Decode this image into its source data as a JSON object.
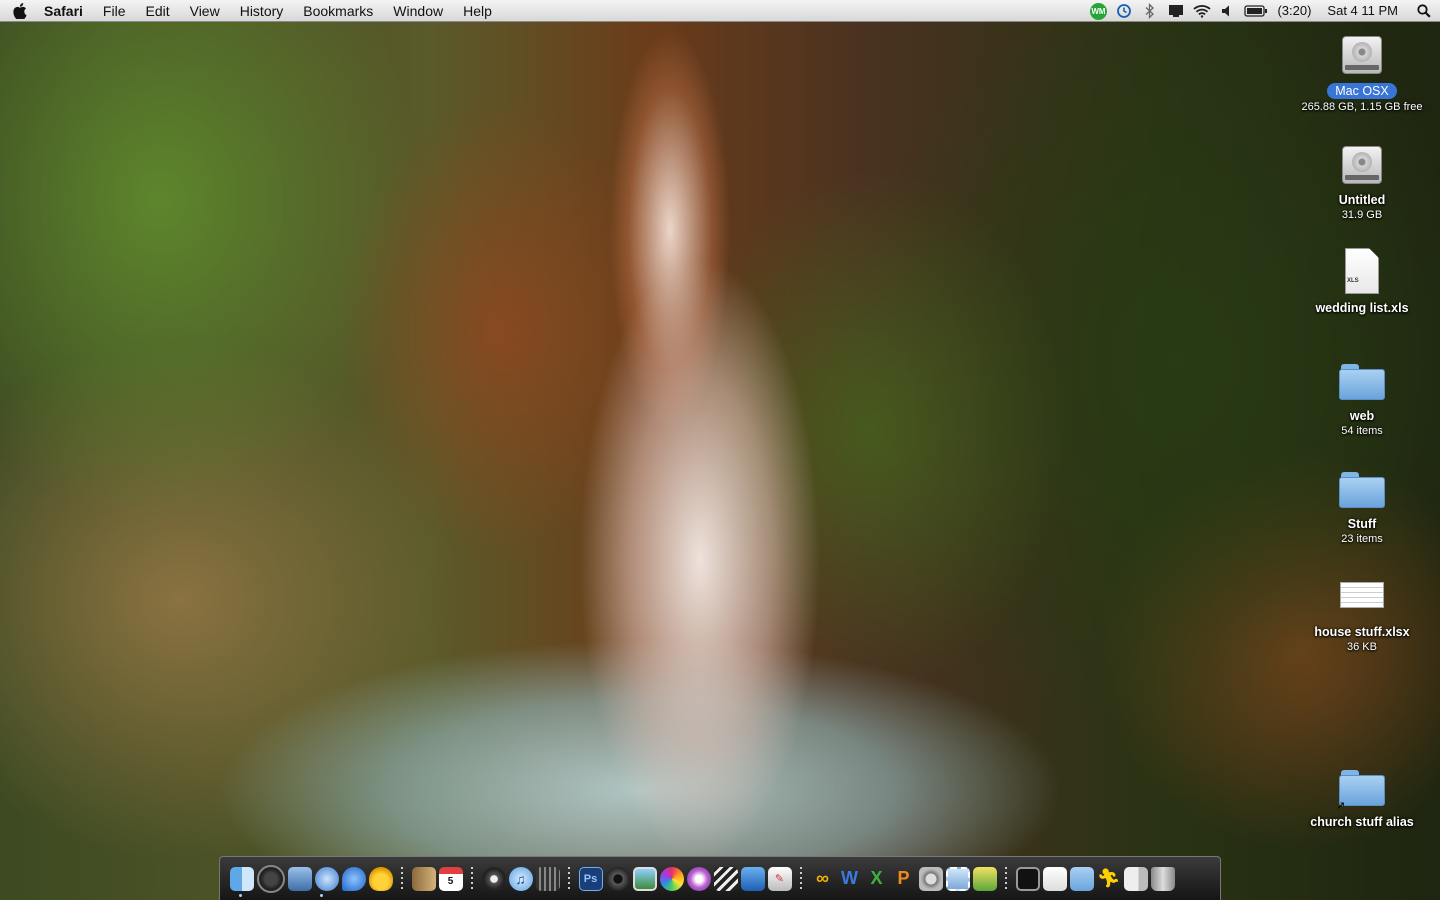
{
  "menubar": {
    "app_name": "Safari",
    "menus": [
      "File",
      "Edit",
      "View",
      "History",
      "Bookmarks",
      "Window",
      "Help"
    ],
    "status": {
      "wm_badge": "WM",
      "battery": "(3:20)",
      "clock": "Sat 4 11 PM"
    }
  },
  "desktop": {
    "items": [
      {
        "name": "Mac OSX",
        "info": "265.88 GB, 1.15 GB free",
        "kind": "hard-drive",
        "selected": true
      },
      {
        "name": "Untitled",
        "info": "31.9 GB",
        "kind": "hard-drive"
      },
      {
        "name": "wedding list.xls",
        "info": "",
        "kind": "document",
        "tag": "XLS"
      },
      {
        "name": "web",
        "info": "54 items",
        "kind": "folder"
      },
      {
        "name": "Stuff",
        "info": "23 items",
        "kind": "folder"
      },
      {
        "name": "house stuff.xlsx",
        "info": "36 KB",
        "kind": "spreadsheet"
      },
      {
        "name": "church stuff alias",
        "info": "",
        "kind": "folder-alias"
      }
    ]
  },
  "dock": {
    "calendar_day": "5",
    "photoshop_label": "Ps",
    "groups": [
      [
        "finder-icon",
        "dashboard-icon",
        "preview-icon",
        "safari-icon",
        "ichat-icon",
        "adium-icon"
      ],
      [
        "address-book-icon",
        "ical-icon"
      ],
      [
        "front-row-icon",
        "itunes-icon",
        "imovie-icon"
      ],
      [
        "photoshop-icon",
        "dvd-player-icon",
        "iphoto-icon",
        "colorsync-icon",
        "ipod-icon",
        "final-cut-icon",
        "app-store-icon",
        "script-icon"
      ],
      [
        "word-icon",
        "excel-icon",
        "powerpoint-icon",
        "system-prefs-icon",
        "screen-capture-icon",
        "folder-app-icon"
      ],
      [
        "activity-monitor-icon",
        "documents-stack-icon",
        "applications-stack-icon",
        "limewire-icon",
        "downloads-stack-icon",
        "trash-icon"
      ]
    ]
  },
  "colors": {
    "menubar": "#e6e6e6",
    "selection": "#3875d7",
    "folder": "#8fc0ea"
  }
}
